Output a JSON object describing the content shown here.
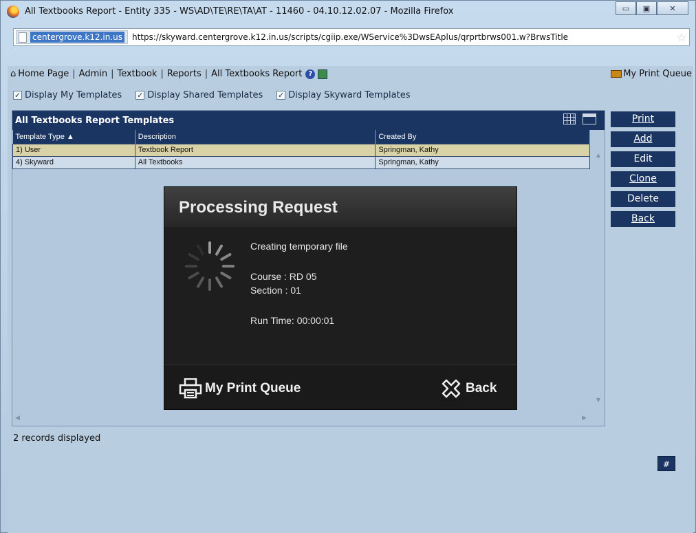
{
  "window": {
    "title": "All Textbooks Report - Entity 335 - WS\\AD\\TE\\RE\\TA\\AT - 11460 - 04.10.12.02.07 - Mozilla Firefox",
    "buttons": {
      "minimize": "▭",
      "maximize": "▣",
      "close": "✕"
    }
  },
  "urlbar": {
    "site": "centergrove.k12.in.us",
    "url": "https://skyward.centergrove.k12.in.us/scripts/cgiip.exe/WService%3DwsEAplus/qrprtbrws001.w?BrwsTitle"
  },
  "nav": {
    "items": [
      "Home Page",
      "Admin",
      "Textbook",
      "Reports",
      "All Textbooks Report"
    ],
    "print_queue": "My Print Queue"
  },
  "filters": [
    {
      "label": "Display My Templates",
      "checked": true
    },
    {
      "label": "Display Shared Templates",
      "checked": true
    },
    {
      "label": "Display Skyward Templates",
      "checked": true
    }
  ],
  "panel": {
    "title": "All Textbooks Report Templates",
    "columns": [
      "Template Type ▲",
      "Description",
      "Created By"
    ],
    "rows": [
      [
        "1) User",
        "Textbook Report",
        "Springman, Kathy"
      ],
      [
        "4) Skyward",
        "All Textbooks",
        "Springman, Kathy"
      ]
    ]
  },
  "records_text": "2 records displayed",
  "side_buttons": [
    "Print",
    "Add",
    "Edit",
    "Clone",
    "Delete",
    "Back"
  ],
  "hash_button": "#",
  "modal": {
    "title": "Processing Request",
    "status": "Creating temporary file",
    "course": "Course : RD 05",
    "section": "Section : 01",
    "run_time": "Run Time: 00:00:01",
    "print_queue_label": "My Print Queue",
    "back_label": "Back"
  },
  "colors": {
    "nav_blue": "#1b3562",
    "app_bg": "#b8cde0",
    "modal_bg": "#1e1e1e",
    "user_row": "#d9d2a6"
  }
}
